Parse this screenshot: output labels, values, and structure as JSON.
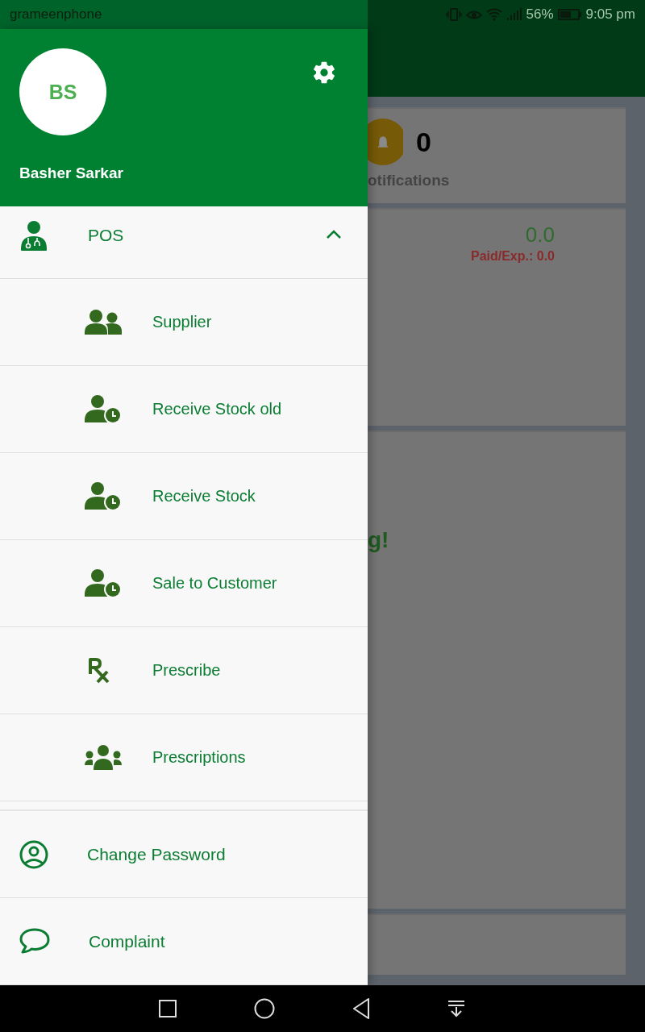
{
  "status_bar": {
    "carrier": "grameenphone",
    "battery": "56%",
    "time": "9:05 pm"
  },
  "drawer": {
    "avatar_initials": "BS",
    "user_name": "Basher Sarkar",
    "menu": [
      {
        "kind": "group",
        "label": "POS",
        "expanded": true,
        "children": [
          {
            "label": "Supplier"
          },
          {
            "label": "Receive Stock old"
          },
          {
            "label": "Receive Stock"
          },
          {
            "label": "Sale to Customer"
          },
          {
            "label": "Prescribe"
          },
          {
            "label": "Prescriptions"
          }
        ]
      },
      {
        "kind": "item",
        "label": "Change Password"
      },
      {
        "kind": "item",
        "label": "Complaint"
      }
    ]
  },
  "background": {
    "notifications": {
      "count": "0",
      "label": "otifications"
    },
    "balance": {
      "amount": "0.0",
      "paid": "Paid/Exp.: 0.0"
    },
    "message": "g!"
  }
}
